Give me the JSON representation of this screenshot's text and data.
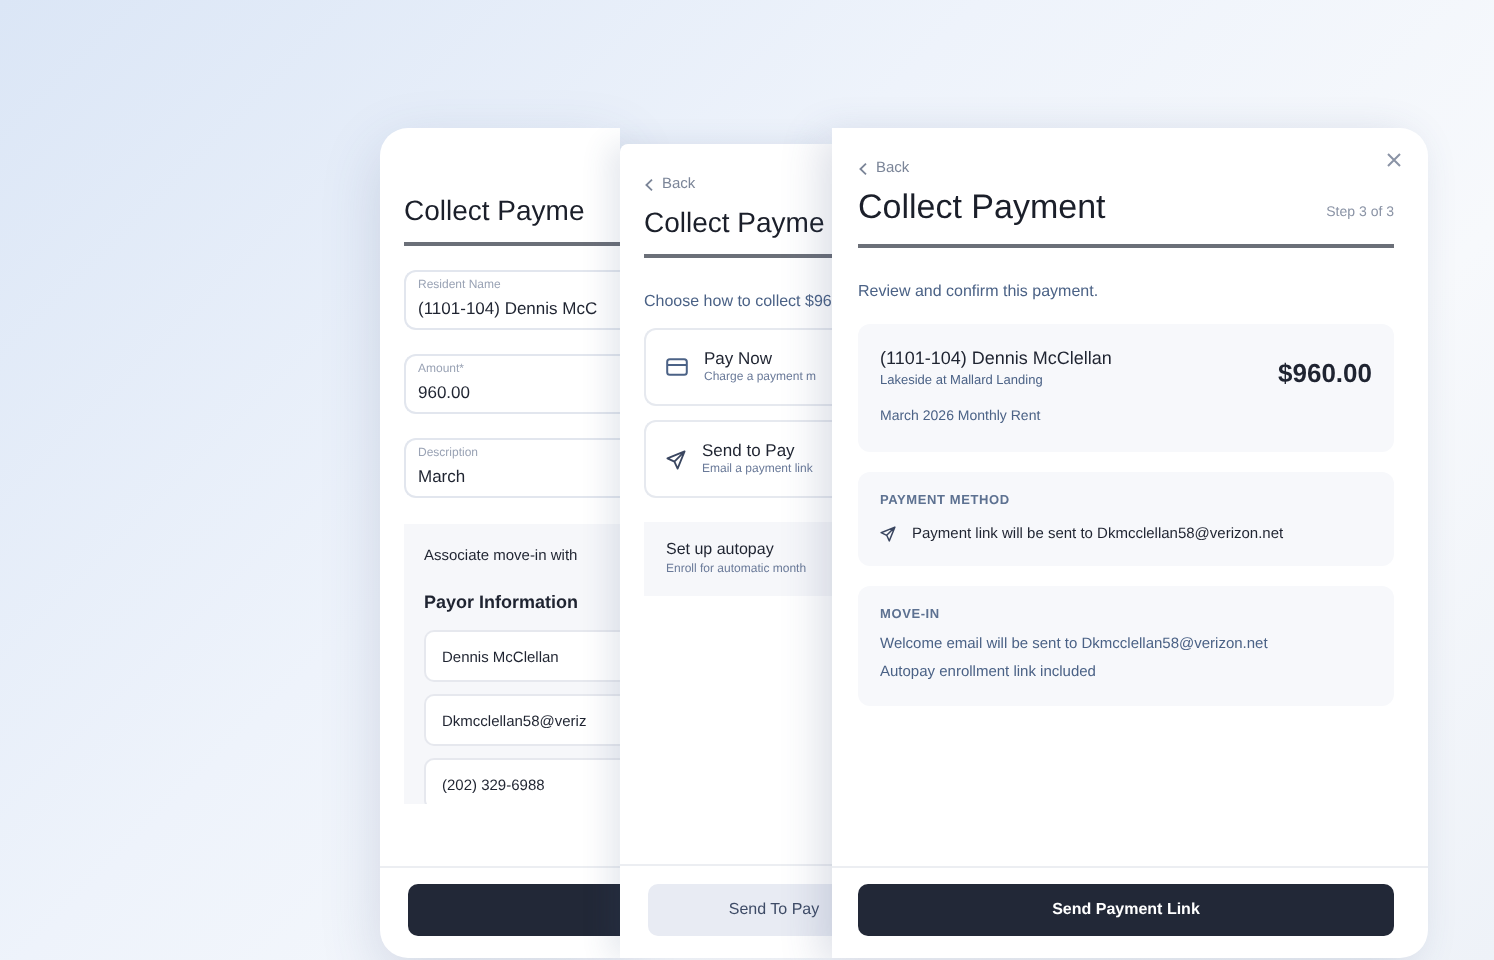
{
  "panels": [
    {
      "kind": "details",
      "title": "Collect Payme",
      "fields": [
        {
          "label": "Resident Name",
          "value": "(1101-104) Dennis McC"
        },
        {
          "label": "Amount*",
          "value": "960.00"
        },
        {
          "label": "Description",
          "value": "March"
        }
      ],
      "section": {
        "text": "Associate move-in with",
        "heading": "Payor Information",
        "inputs": [
          "Dennis McClellan",
          "Dkmcclellan58@veriz",
          "(202) 329-6988"
        ]
      }
    },
    {
      "kind": "method",
      "back": "Back",
      "title": "Collect Payme",
      "prompt": "Choose how to collect $96",
      "options": [
        {
          "kind": "card",
          "title": "Pay Now",
          "subtitle": "Charge a payment m"
        },
        {
          "kind": "send",
          "title": "Send to Pay",
          "subtitle": "Email a payment link"
        }
      ],
      "extra": {
        "title": "Set up autopay",
        "subtitle": "Enroll for automatic month"
      },
      "button": "Send To Pay"
    },
    {
      "kind": "review",
      "back": "Back",
      "title": "Collect Payment",
      "step": "Step 3 of 3",
      "prompt": "Review and confirm this payment.",
      "summary": {
        "name": "(1101-104) Dennis McClellan",
        "property": "Lakeside at Mallard Landing",
        "amount": "$960.00",
        "memo": "March 2026 Monthly Rent"
      },
      "sections": [
        {
          "kind": "method",
          "heading": "PAYMENT METHOD",
          "lines": [
            "Payment link will be sent to Dkmcclellan58@verizon.net"
          ]
        },
        {
          "kind": "plain",
          "heading": "MOVE-IN",
          "lines": [
            "Welcome email will be sent to Dkmcclellan58@verizon.net",
            "Autopay enrollment link included"
          ]
        }
      ],
      "button": "Send Payment Link"
    }
  ]
}
